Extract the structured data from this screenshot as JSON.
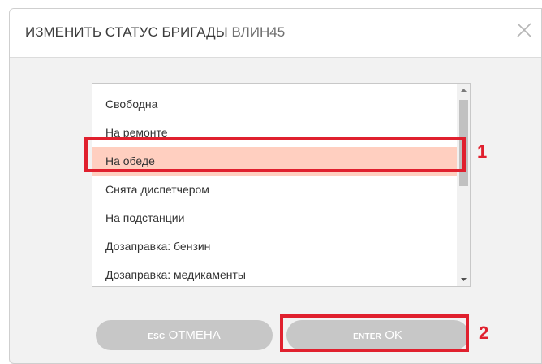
{
  "dialog": {
    "title_prefix": "ИЗМЕНИТЬ СТАТУС БРИГАДЫ",
    "title_unit": "ВЛИН45"
  },
  "status_list": {
    "items": [
      {
        "label": "Свободна",
        "selected": false
      },
      {
        "label": "На ремонте",
        "selected": false
      },
      {
        "label": "На обеде",
        "selected": true
      },
      {
        "label": "Снята диспетчером",
        "selected": false
      },
      {
        "label": "На подстанции",
        "selected": false
      },
      {
        "label": "Дозаправка: бензин",
        "selected": false
      },
      {
        "label": "Дозаправка: медикаменты",
        "selected": false
      }
    ]
  },
  "buttons": {
    "cancel_key": "ESC",
    "cancel_label": "ОТМЕНА",
    "ok_key": "ENTER",
    "ok_label": "OK"
  },
  "annotations": {
    "marker_1": "1",
    "marker_2": "2"
  },
  "colors": {
    "selection": "#ffcfc0",
    "marker": "#e0202e",
    "button": "#c7c7c7"
  },
  "icons": {
    "close": "close-icon",
    "scroll_up": "arrow-up-icon",
    "scroll_down": "arrow-down-icon"
  }
}
